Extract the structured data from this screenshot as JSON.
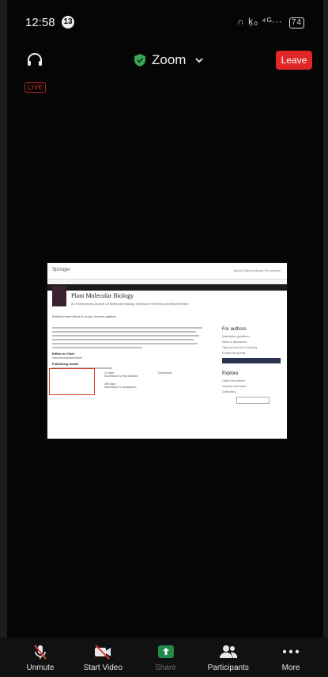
{
  "status_bar": {
    "time": "12:58",
    "notification_count": "13",
    "signal_icons": "∩ ķ₀ ⁴ᴳ∙∙∙",
    "battery": "74"
  },
  "top_bar": {
    "meeting_title": "Zoom",
    "leave_label": "Leave",
    "live_label": "LIVE"
  },
  "shared_screen": {
    "logo": "Springer",
    "nav": "About   Editorial Board   For authors",
    "journal_title": "Plant Molecular Biology",
    "journal_subtitle": "An International Journal on Molecular Biology, Molecular Genetics and Biochemistry",
    "tabs": "Editorial board    Aims & scope    Journal updates",
    "heading_1": "Editor-in-Chief",
    "heading_2": "Publishing model",
    "sidebar_title": "For authors",
    "sidebar_links": [
      "Submission guidelines",
      "Ethics & disclosures",
      "Open access fees & funding",
      "Contact the journal"
    ],
    "sidebar_title_2": "Explore",
    "sidebar_links_2": [
      "Online first articles",
      "Volumes and issues",
      "Collections"
    ],
    "metric_1": "19 days",
    "metric_1_sub": "Submission to first decision",
    "metric_2": "Downloads",
    "metric_3": "189 days",
    "metric_3_sub": "Submission to acceptance"
  },
  "toolbar": {
    "unmute": "Unmute",
    "start_video": "Start Video",
    "share": "Share",
    "participants": "Participants",
    "more": "More"
  },
  "colors": {
    "leave": "#e02626",
    "share_icon": "#1f8a4c",
    "shield": "#3aa55a"
  }
}
